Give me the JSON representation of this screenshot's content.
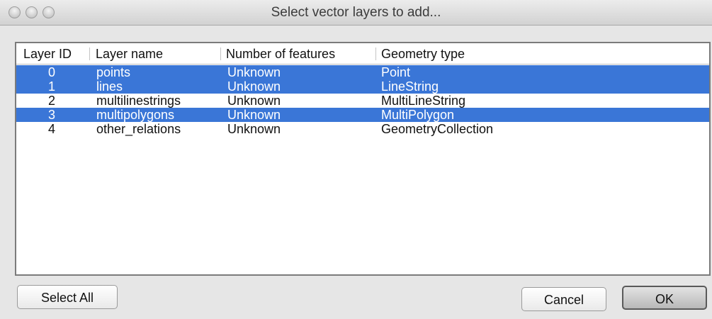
{
  "window": {
    "title": "Select vector layers to add..."
  },
  "table": {
    "headers": [
      "Layer ID",
      "Layer name",
      "Number of features",
      "Geometry type"
    ],
    "rows": [
      {
        "id": "0",
        "name": "points",
        "features": "Unknown",
        "geometry": "Point",
        "selected": true
      },
      {
        "id": "1",
        "name": "lines",
        "features": "Unknown",
        "geometry": "LineString",
        "selected": true
      },
      {
        "id": "2",
        "name": "multilinestrings",
        "features": "Unknown",
        "geometry": "MultiLineString",
        "selected": false
      },
      {
        "id": "3",
        "name": "multipolygons",
        "features": "Unknown",
        "geometry": "MultiPolygon",
        "selected": true
      },
      {
        "id": "4",
        "name": "other_relations",
        "features": "Unknown",
        "geometry": "GeometryCollection",
        "selected": false
      }
    ]
  },
  "buttons": {
    "select_all": "Select All",
    "cancel": "Cancel",
    "ok": "OK"
  },
  "colors": {
    "selection": "#3a76d7"
  }
}
